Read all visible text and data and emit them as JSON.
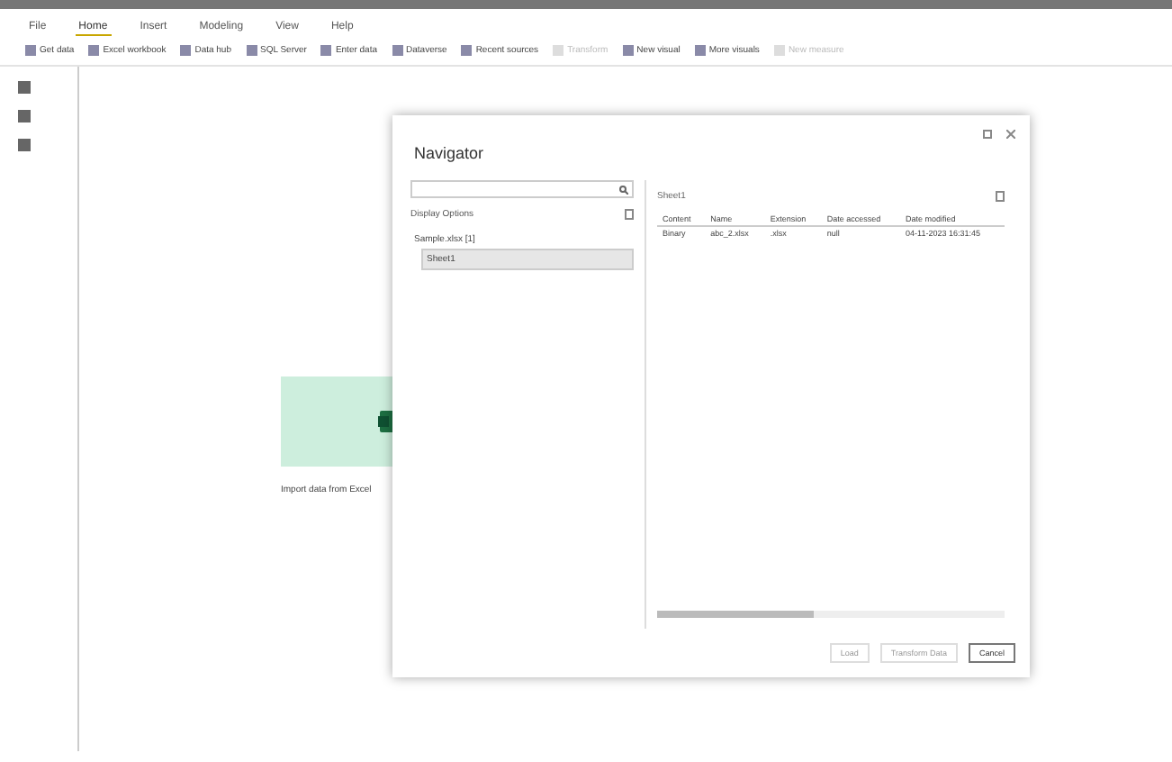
{
  "menu": [
    {
      "label": "File",
      "selected": false
    },
    {
      "label": "Home",
      "selected": true
    },
    {
      "label": "Insert",
      "selected": false
    },
    {
      "label": "Modeling",
      "selected": false
    },
    {
      "label": "View",
      "selected": false
    },
    {
      "label": "Help",
      "selected": false
    }
  ],
  "ribbon": [
    {
      "label": "Get data",
      "disabled": false
    },
    {
      "label": "Excel workbook",
      "disabled": false
    },
    {
      "label": "Data hub",
      "disabled": false
    },
    {
      "label": "SQL Server",
      "disabled": false
    },
    {
      "label": "Enter data",
      "disabled": false
    },
    {
      "label": "Dataverse",
      "disabled": false
    },
    {
      "label": "Recent sources",
      "disabled": false
    },
    {
      "label": "Transform",
      "disabled": true
    },
    {
      "label": "New visual",
      "disabled": false
    },
    {
      "label": "More visuals",
      "disabled": false
    },
    {
      "label": "New measure",
      "disabled": true
    }
  ],
  "canvas_card": {
    "label": "Import data from Excel"
  },
  "navigator": {
    "title": "Navigator",
    "display_options": "Display Options",
    "tree": [
      {
        "label": "Sample.xlsx [1]",
        "selected": false,
        "children": [
          {
            "label": "Sheet1",
            "selected": true
          }
        ]
      }
    ],
    "preview_title": "Sheet1",
    "table": {
      "columns": [
        "Content",
        "Name",
        "Extension",
        "Date accessed",
        "Date modified"
      ],
      "rows": [
        [
          "Binary",
          "abc_2.xlsx",
          ".xlsx",
          "null",
          "04-11-2023 16:31:45"
        ]
      ]
    },
    "buttons": [
      {
        "label": "Load",
        "primary": false
      },
      {
        "label": "Transform Data",
        "primary": false
      },
      {
        "label": "Cancel",
        "primary": true
      }
    ]
  }
}
